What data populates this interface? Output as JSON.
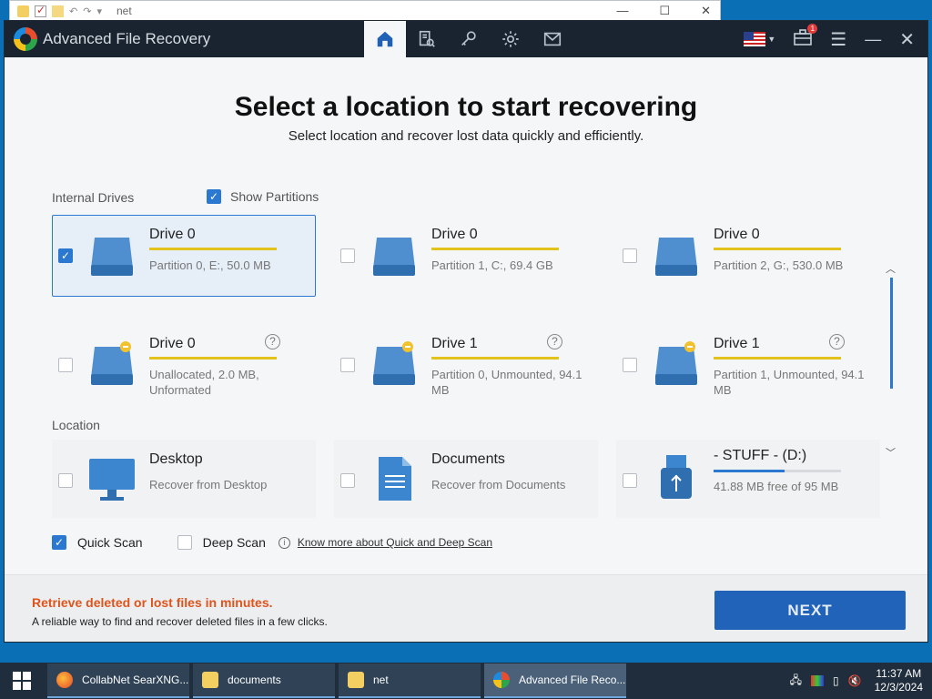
{
  "background_window": {
    "title": "net"
  },
  "app": {
    "title": "Advanced File Recovery",
    "tabs": [
      {
        "name": "home",
        "icon": "home-icon",
        "active": true
      },
      {
        "name": "scan-log",
        "icon": "search-document-icon",
        "active": false
      },
      {
        "name": "license",
        "icon": "key-icon",
        "active": false
      },
      {
        "name": "settings",
        "icon": "gear-icon",
        "active": false
      },
      {
        "name": "mail",
        "icon": "envelope-icon",
        "active": false
      }
    ],
    "notification_count": "1"
  },
  "main": {
    "heading": "Select a location to start recovering",
    "subheading": "Select location and recover lost data quickly and efficiently.",
    "internal_drives_label": "Internal Drives",
    "show_partitions_label": "Show Partitions",
    "show_partitions_checked": true,
    "drives": [
      {
        "name": "Drive 0",
        "detail": "Partition 0,  E:,  50.0 MB",
        "checked": true,
        "warning": false,
        "help": false
      },
      {
        "name": "Drive 0",
        "detail": "Partition 1,  C:,  69.4 GB",
        "checked": false,
        "warning": false,
        "help": false
      },
      {
        "name": "Drive 0",
        "detail": "Partition 2,  G:,  530.0 MB",
        "checked": false,
        "warning": false,
        "help": false
      },
      {
        "name": "Drive 0",
        "detail": "Unallocated, 2.0 MB, Unformated",
        "checked": false,
        "warning": true,
        "help": true
      },
      {
        "name": "Drive 1",
        "detail": "Partition 0,  Unmounted, 94.1 MB",
        "checked": false,
        "warning": true,
        "help": true
      },
      {
        "name": "Drive 1",
        "detail": "Partition 1,  Unmounted, 94.1 MB",
        "checked": false,
        "warning": true,
        "help": true
      }
    ],
    "location_label": "Location",
    "locations": [
      {
        "name": "Desktop",
        "detail": "Recover from Desktop",
        "icon": "monitor-icon"
      },
      {
        "name": "Documents",
        "detail": "Recover from Documents",
        "icon": "document-icon"
      },
      {
        "name": "- STUFF - (D:)",
        "detail": "41.88 MB free of 95 MB",
        "icon": "usb-drive-icon",
        "used_fraction": 0.56
      }
    ],
    "quick_scan_label": "Quick Scan",
    "quick_scan_checked": true,
    "deep_scan_label": "Deep Scan",
    "deep_scan_checked": false,
    "know_more_link": "Know more about Quick and Deep Scan"
  },
  "footer": {
    "promo": "Retrieve deleted or lost files in minutes.",
    "promo_sub": "A reliable way to find and recover deleted files in a few clicks.",
    "next_label": "NEXT"
  },
  "taskbar": {
    "items": [
      {
        "label": "CollabNet SearXNG...",
        "icon": "firefox-icon"
      },
      {
        "label": "documents",
        "icon": "folder-icon"
      },
      {
        "label": "net",
        "icon": "folder-icon"
      },
      {
        "label": "Advanced File Reco...",
        "icon": "afr-icon"
      }
    ],
    "time": "11:37 AM",
    "date": "12/3/2024"
  },
  "colors": {
    "accent": "#2b78d0",
    "titlebar": "#192430",
    "promo": "#e0541c",
    "next_button": "#2063b8"
  }
}
